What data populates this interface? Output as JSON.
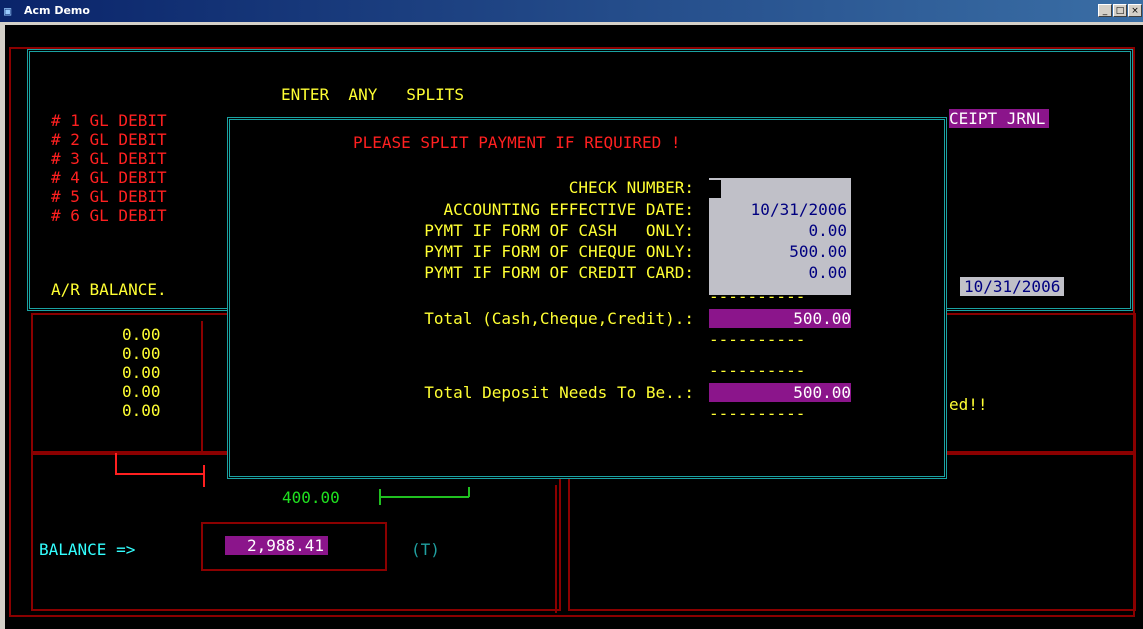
{
  "window": {
    "title": "Acm Demo",
    "min": "_",
    "max": "□",
    "close": "×"
  },
  "bg": {
    "header": "ENTER  ANY   SPLITS",
    "gl_rows": [
      "# 1 GL DEBIT",
      "# 2 GL DEBIT",
      "# 3 GL DEBIT",
      "# 4 GL DEBIT",
      "# 5 GL DEBIT",
      "# 6 GL DEBIT"
    ],
    "receipt_jrnl": "CEIPT JRNL",
    "ar_balance": "A/R BALANCE.",
    "right_date": "10/31/2006",
    "zeros": [
      "0.00",
      "0.00",
      "0.00",
      "0.00",
      "0.00"
    ],
    "ed_msg": "ed!!",
    "green_amount": "400.00",
    "balance_label": "BALANCE =>",
    "balance_value": "2,988.41",
    "balance_flag": "(T)"
  },
  "dialog": {
    "heading": "PLEASE SPLIT PAYMENT IF REQUIRED !",
    "fields": [
      {
        "label": "CHECK NUMBER:",
        "value": ""
      },
      {
        "label": "ACCOUNTING EFFECTIVE DATE:",
        "value": "10/31/2006"
      },
      {
        "label": "PYMT IF FORM OF CASH   ONLY:",
        "value": "0.00"
      },
      {
        "label": "PYMT IF FORM OF CHEQUE ONLY:",
        "value": "500.00"
      },
      {
        "label": "PYMT IF FORM OF CREDIT CARD:",
        "value": "0.00"
      }
    ],
    "dash": "----------",
    "total_label": "Total (Cash,Cheque,Credit).:",
    "total_value": "500.00",
    "deposit_label": "Total Deposit Needs To Be..:",
    "deposit_value": "500.00"
  }
}
